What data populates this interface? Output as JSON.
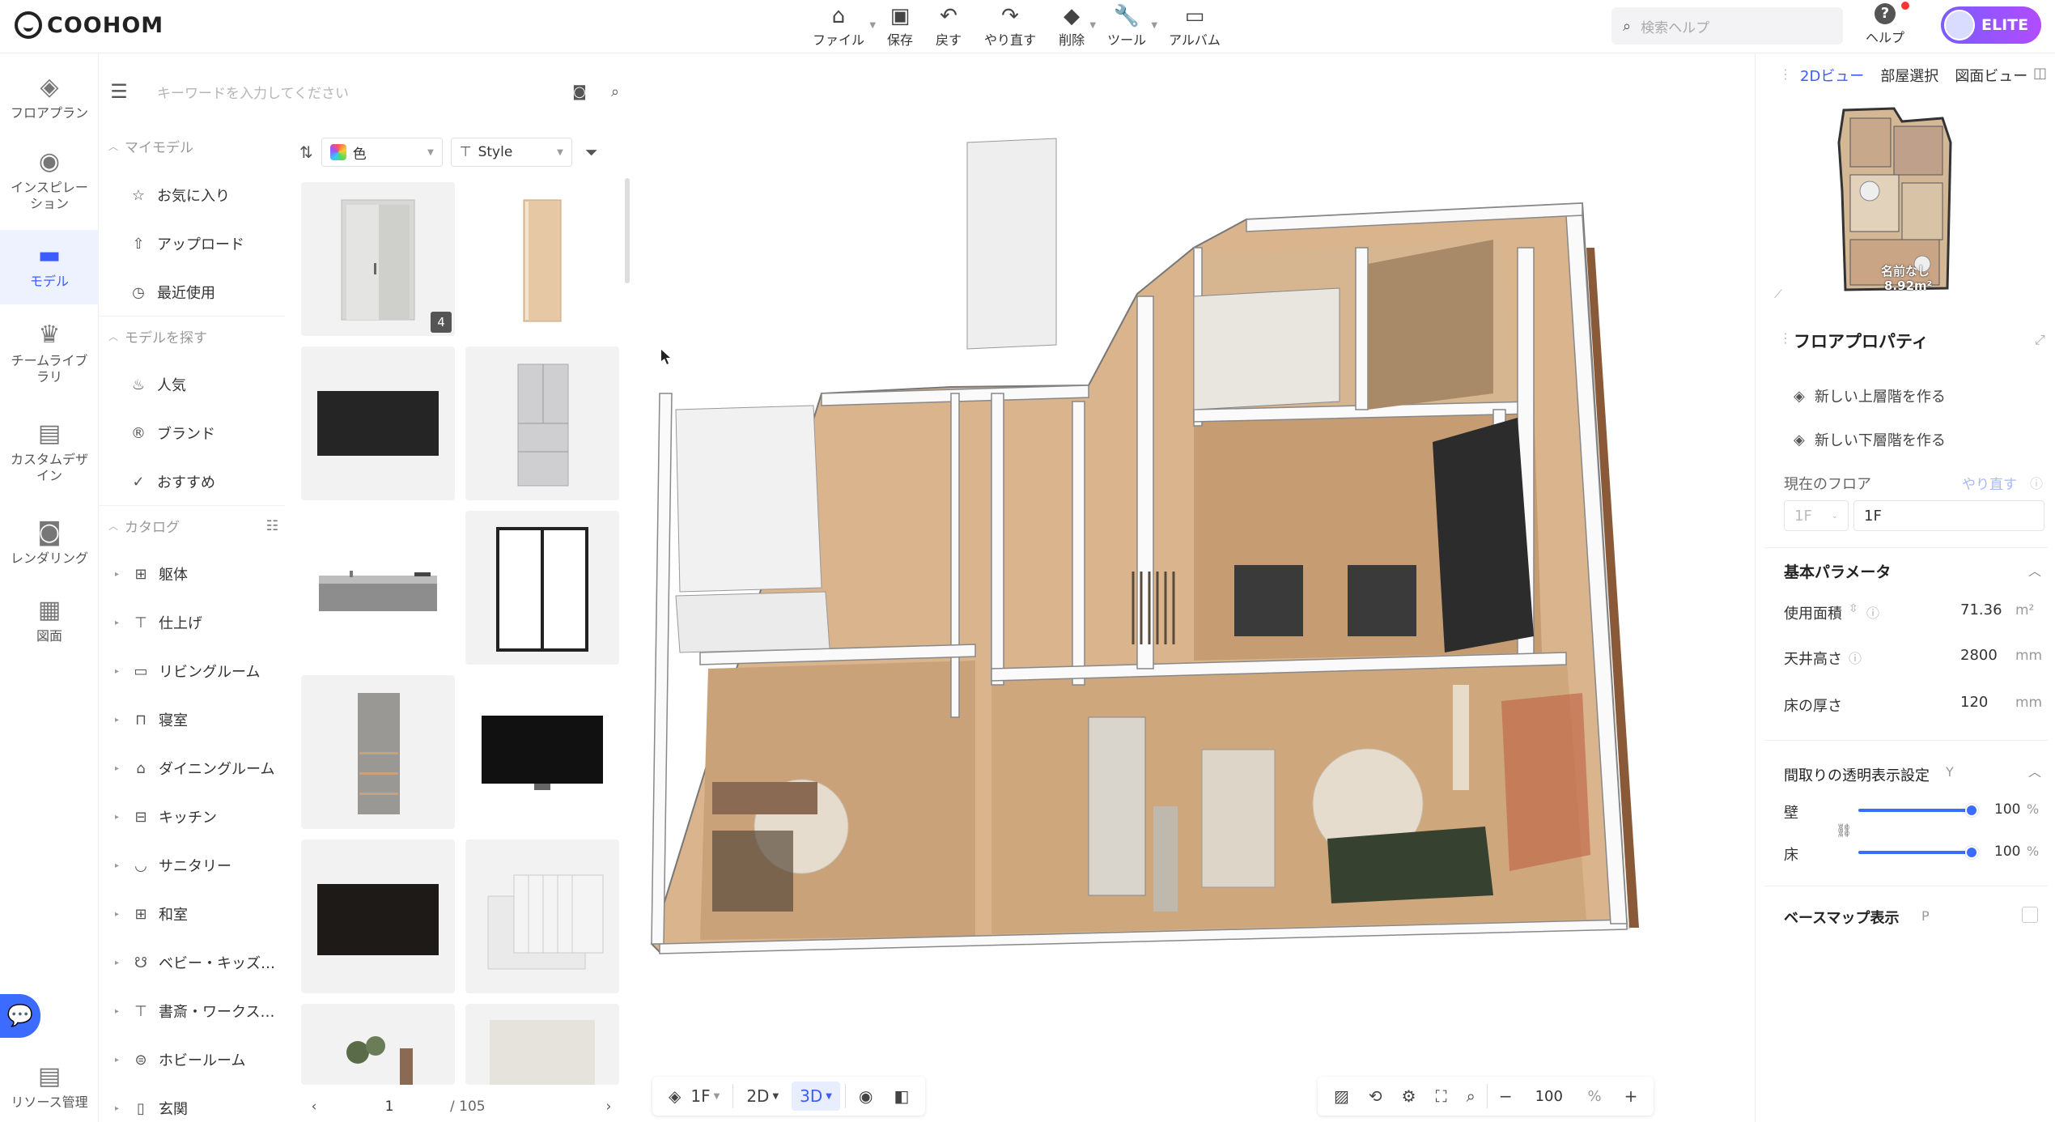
{
  "app": {
    "logo_text": "COOHOM"
  },
  "toolbar": {
    "items": [
      {
        "label": "ファイル",
        "icon": "home-icon",
        "dropdown": true
      },
      {
        "label": "保存",
        "icon": "save-icon",
        "dropdown": false
      },
      {
        "label": "戻す",
        "icon": "undo-icon",
        "dropdown": false
      },
      {
        "label": "やり直す",
        "icon": "redo-icon",
        "dropdown": false
      },
      {
        "label": "削除",
        "icon": "eraser-icon",
        "dropdown": true
      },
      {
        "label": "ツール",
        "icon": "wrench-icon",
        "dropdown": true
      },
      {
        "label": "アルバム",
        "icon": "album-icon",
        "dropdown": false
      }
    ],
    "help_search_placeholder": "検索ヘルプ",
    "help_label": "ヘルプ",
    "elite_label": "ELITE"
  },
  "leftnav": {
    "items": [
      {
        "label": "フロアプラン",
        "icon": "floorplan-icon"
      },
      {
        "label": "インスピレーション",
        "icon": "bulb-icon"
      },
      {
        "label": "モデル",
        "icon": "sofa-icon",
        "active": true
      },
      {
        "label": "チームライブラリ",
        "icon": "crown-icon"
      },
      {
        "label": "カスタムデザイン",
        "icon": "custom-box-icon"
      },
      {
        "label": "レンダリング",
        "icon": "camera-icon"
      },
      {
        "label": "図面",
        "icon": "drawing-icon"
      }
    ],
    "bottom_label": "リソース管理"
  },
  "catalog": {
    "search_placeholder": "キーワードを入力してください",
    "my_models_title": "マイモデル",
    "my_models": [
      {
        "label": "お気に入り",
        "icon": "star-icon"
      },
      {
        "label": "アップロード",
        "icon": "upload-icon"
      },
      {
        "label": "最近使用",
        "icon": "clock-icon"
      }
    ],
    "find_title": "モデルを探す",
    "find_items": [
      {
        "label": "人気",
        "icon": "fire-icon"
      },
      {
        "label": "ブランド",
        "icon": "brand-icon"
      },
      {
        "label": "おすすめ",
        "icon": "check-circle-icon"
      }
    ],
    "catalog_title": "カタログ",
    "categories": [
      {
        "label": "躯体",
        "icon": "structure-icon"
      },
      {
        "label": "仕上げ",
        "icon": "roller-icon"
      },
      {
        "label": "リビングルーム",
        "icon": "sofa-icon"
      },
      {
        "label": "寝室",
        "icon": "bed-icon"
      },
      {
        "label": "ダイニングルーム",
        "icon": "dining-icon"
      },
      {
        "label": "キッチン",
        "icon": "kitchen-icon"
      },
      {
        "label": "サニタリー",
        "icon": "bath-icon"
      },
      {
        "label": "和室",
        "icon": "washitsu-icon"
      },
      {
        "label": "ベビー・キッズ…",
        "icon": "baby-icon"
      },
      {
        "label": "書斎・ワークス…",
        "icon": "desk-icon"
      },
      {
        "label": "ホビールーム",
        "icon": "game-icon"
      },
      {
        "label": "玄関",
        "icon": "door-icon"
      }
    ]
  },
  "grid": {
    "color_filter": "色",
    "style_filter": "Style",
    "first_badge": "4",
    "page_current": "1",
    "page_total": "/ 105"
  },
  "canvas": {
    "floor_label": "1F",
    "mode_2d": "2D",
    "mode_3d": "3D",
    "zoom_value": "100",
    "zoom_unit": "%"
  },
  "rightpanel": {
    "tabs": [
      "2Dビュー",
      "部屋選択",
      "図面ビュー"
    ],
    "minimap_room_label": "名前なし",
    "minimap_room_area": "8.92m²",
    "title": "フロアプロパティ",
    "new_upper": "新しい上層階を作る",
    "new_lower": "新しい下層階を作る",
    "current_floor_label": "現在のフロア",
    "redo_link": "やり直す",
    "floor_select": "1F",
    "floor_name": "1F",
    "basic_params_title": "基本パラメータ",
    "area_label": "使用面積",
    "area_value": "71.36",
    "area_unit": "m²",
    "ceiling_label": "天井高さ",
    "ceiling_value": "2800",
    "ceiling_unit": "mm",
    "floor_thick_label": "床の厚さ",
    "floor_thick_value": "120",
    "floor_thick_unit": "mm",
    "transparency_title": "間取りの透明表示設定",
    "transparency_key": "Y",
    "wall_label": "壁",
    "wall_value": "100",
    "floor_label": "床",
    "floor_value": "100",
    "percent": "%",
    "basemap_label": "ベースマップ表示",
    "basemap_key": "P"
  },
  "colors": {
    "accent": "#3c5cff",
    "wood": "#c9a27a",
    "wall": "#ffffff"
  }
}
